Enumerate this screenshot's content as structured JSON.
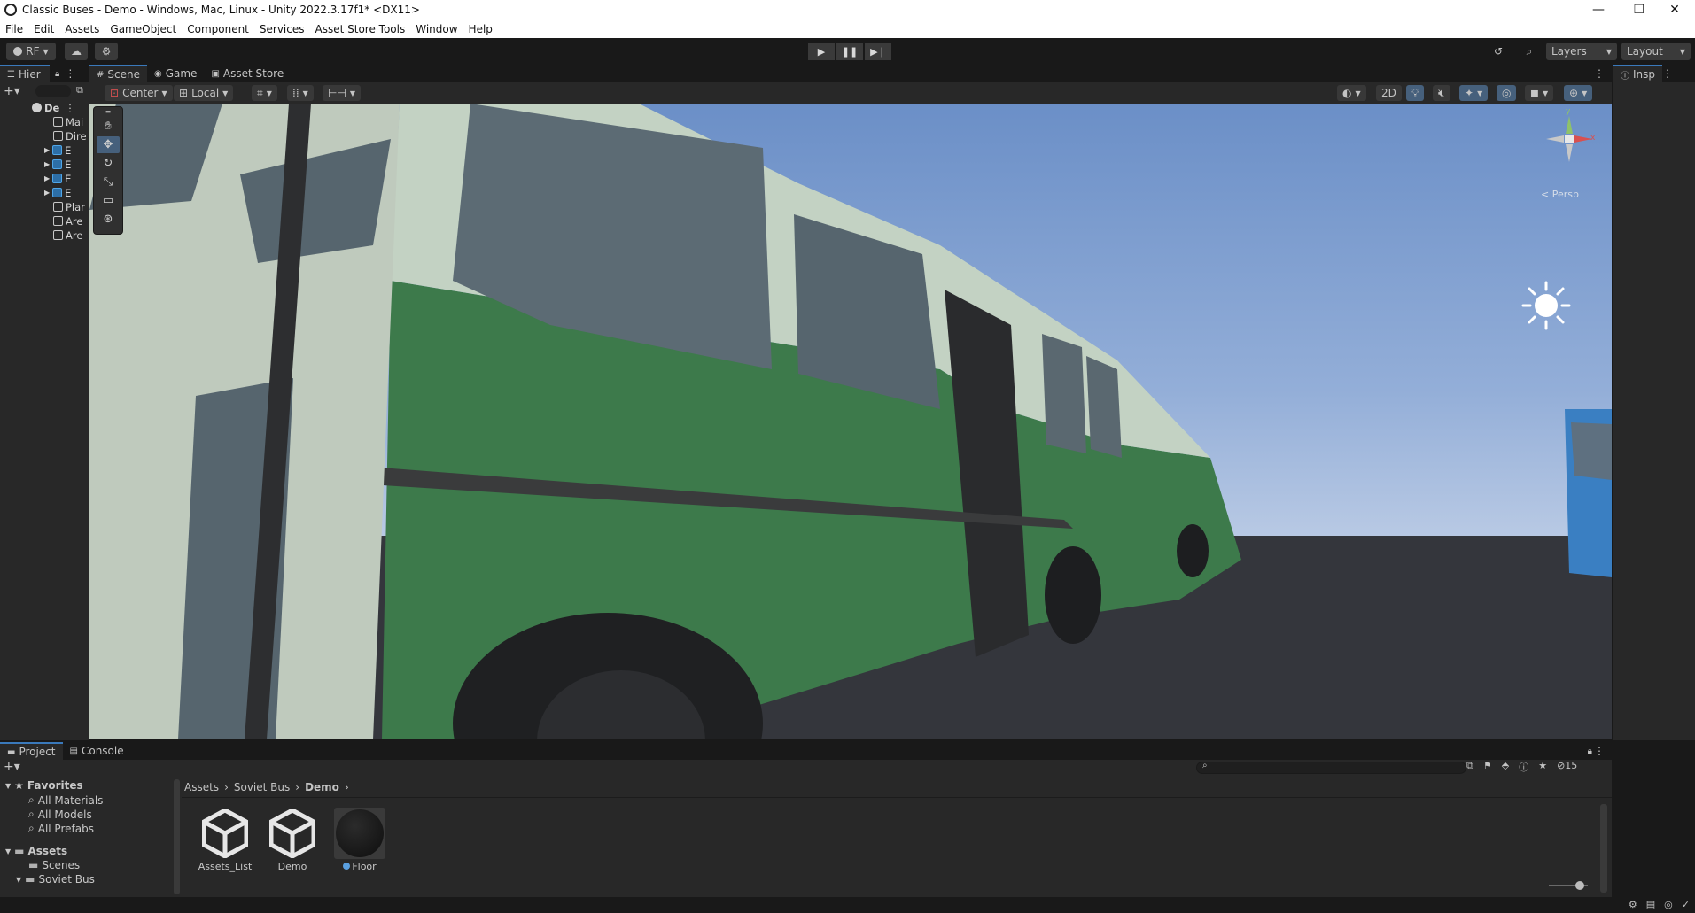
{
  "window": {
    "title": "Classic Buses - Demo - Windows, Mac, Linux - Unity 2022.3.17f1* <DX11>",
    "minimize": "—",
    "maximize": "❐",
    "close": "✕"
  },
  "menu": [
    "File",
    "Edit",
    "Assets",
    "GameObject",
    "Component",
    "Services",
    "Asset Store Tools",
    "Window",
    "Help"
  ],
  "toolbar": {
    "account": "RF",
    "layers": "Layers",
    "layout": "Layout"
  },
  "hierarchy": {
    "tab": "Hier",
    "scene": "De",
    "items": [
      "Mai",
      "Dire",
      "E",
      "E",
      "E",
      "E",
      "Plar",
      "Are",
      "Are"
    ]
  },
  "scene_tabs": [
    "Scene",
    "Game",
    "Asset Store"
  ],
  "scene_toolbar": {
    "pivot": "Center",
    "space": "Local",
    "mode_2d": "2D"
  },
  "gizmo": {
    "projection": "Persp",
    "x": "x",
    "y": "y"
  },
  "inspector": {
    "tab": "Insp"
  },
  "project_tabs": [
    "Project",
    "Console"
  ],
  "project": {
    "favorites_label": "Favorites",
    "favorites": [
      "All Materials",
      "All Models",
      "All Prefabs"
    ],
    "assets_label": "Assets",
    "folders": [
      "Scenes",
      "Soviet Bus"
    ],
    "breadcrumb": [
      "Assets",
      "Soviet Bus",
      "Demo"
    ],
    "hidden_count": "15",
    "assets": [
      {
        "name": "Assets_List",
        "kind": "unity-scene"
      },
      {
        "name": "Demo",
        "kind": "unity-scene"
      },
      {
        "name": "Floor",
        "kind": "material"
      }
    ]
  }
}
